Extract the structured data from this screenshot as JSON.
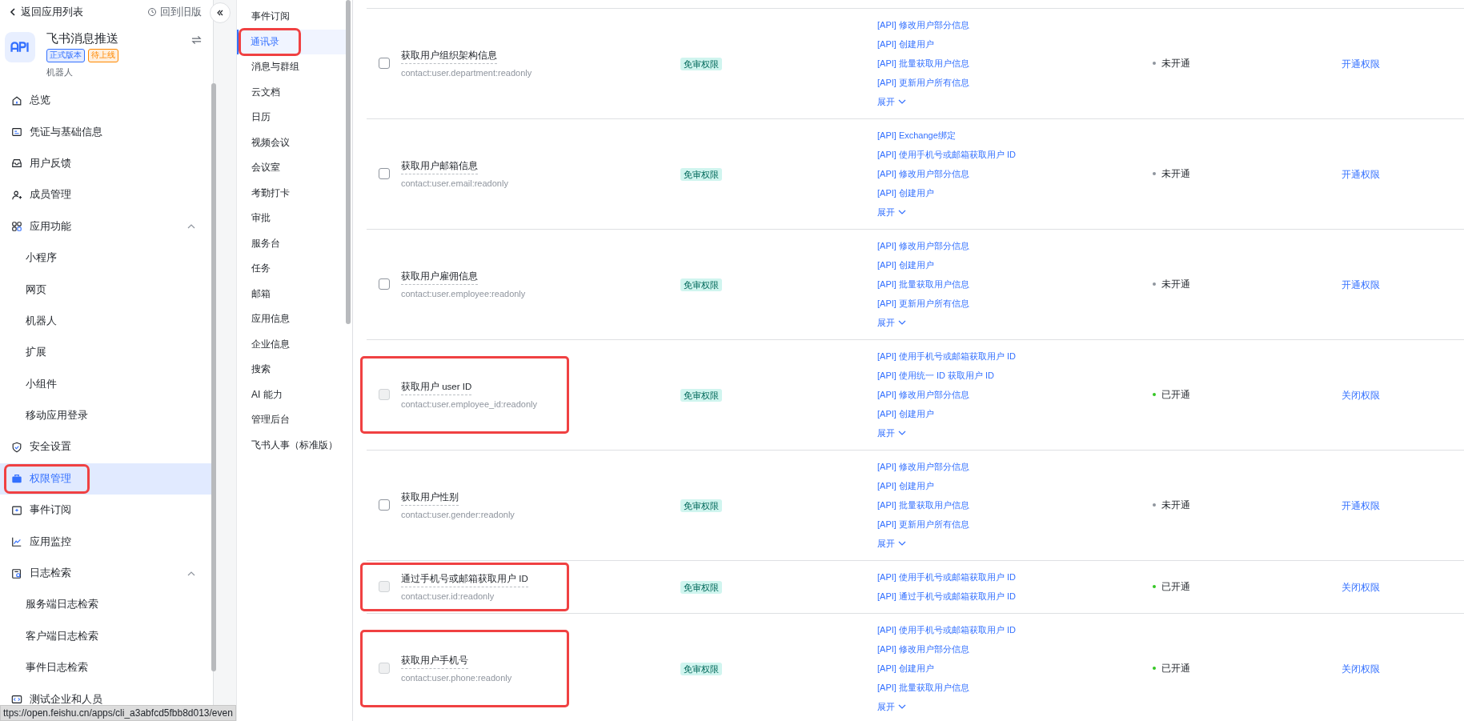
{
  "sidebar": {
    "back_link": "返回应用列表",
    "old_version_link": "回到旧版",
    "app": {
      "name": "飞书消息推送",
      "type": "机器人",
      "tags": [
        {
          "label": "正式版本",
          "color": "#3370ff"
        },
        {
          "label": "待上线",
          "color": "#ff8800"
        }
      ]
    },
    "items": [
      {
        "label": "总览",
        "kind": "item",
        "selected": false,
        "annotated": false
      },
      {
        "label": "凭证与基础信息",
        "kind": "item",
        "selected": false,
        "annotated": false
      },
      {
        "label": "用户反馈",
        "kind": "item",
        "selected": false,
        "annotated": false
      },
      {
        "label": "成员管理",
        "kind": "item",
        "selected": false,
        "annotated": false
      },
      {
        "label": "应用功能",
        "kind": "group",
        "expanded": true,
        "selected": false,
        "annotated": false,
        "children": [
          {
            "label": "小程序",
            "selected": false
          },
          {
            "label": "网页",
            "selected": false
          },
          {
            "label": "机器人",
            "selected": false
          },
          {
            "label": "扩展",
            "selected": false
          },
          {
            "label": "小组件",
            "selected": false
          },
          {
            "label": "移动应用登录",
            "selected": false
          }
        ]
      },
      {
        "label": "安全设置",
        "kind": "item",
        "selected": false,
        "annotated": false
      },
      {
        "label": "权限管理",
        "kind": "item",
        "selected": true,
        "annotated": true
      },
      {
        "label": "事件订阅",
        "kind": "item",
        "selected": false,
        "annotated": false
      },
      {
        "label": "应用监控",
        "kind": "item",
        "selected": false,
        "annotated": false
      },
      {
        "label": "日志检索",
        "kind": "group",
        "expanded": true,
        "selected": false,
        "annotated": false,
        "children": [
          {
            "label": "服务端日志检索",
            "selected": false
          },
          {
            "label": "客户端日志检索",
            "selected": false
          },
          {
            "label": "事件日志检索",
            "selected": false
          }
        ]
      },
      {
        "label": "测试企业和人员",
        "kind": "item",
        "selected": false,
        "annotated": false
      }
    ]
  },
  "status_url": "ttps://open.feishu.cn/apps/cli_a3abfcd5fbb8d013/even",
  "category_nav": [
    {
      "label": "事件订阅",
      "selected": false,
      "annotated": false
    },
    {
      "label": "通讯录",
      "selected": true,
      "annotated": true
    },
    {
      "label": "消息与群组",
      "selected": false,
      "annotated": false
    },
    {
      "label": "云文档",
      "selected": false,
      "annotated": false
    },
    {
      "label": "日历",
      "selected": false,
      "annotated": false
    },
    {
      "label": "视频会议",
      "selected": false,
      "annotated": false
    },
    {
      "label": "会议室",
      "selected": false,
      "annotated": false
    },
    {
      "label": "考勤打卡",
      "selected": false,
      "annotated": false
    },
    {
      "label": "审批",
      "selected": false,
      "annotated": false
    },
    {
      "label": "服务台",
      "selected": false,
      "annotated": false
    },
    {
      "label": "任务",
      "selected": false,
      "annotated": false
    },
    {
      "label": "邮箱",
      "selected": false,
      "annotated": false
    },
    {
      "label": "应用信息",
      "selected": false,
      "annotated": false
    },
    {
      "label": "企业信息",
      "selected": false,
      "annotated": false
    },
    {
      "label": "搜索",
      "selected": false,
      "annotated": false
    },
    {
      "label": "AI 能力",
      "selected": false,
      "annotated": false
    },
    {
      "label": "管理后台",
      "selected": false,
      "annotated": false
    },
    {
      "label": "飞书人事（标准版）",
      "selected": false,
      "annotated": false
    }
  ],
  "permissions": [
    {
      "name": "获取用户组织架构信息",
      "scope": "contact:user.department:readonly",
      "tag": "免审权限",
      "apis": [
        "[API] 修改用户部分信息",
        "[API] 创建用户",
        "[API] 批量获取用户信息",
        "[API] 更新用户所有信息"
      ],
      "expand": "展开",
      "status": "未开通",
      "enabled": false,
      "action": "开通权限",
      "disabled": false,
      "annotated": false
    },
    {
      "name": "获取用户邮箱信息",
      "scope": "contact:user.email:readonly",
      "tag": "免审权限",
      "apis": [
        "[API] Exchange绑定",
        "[API] 使用手机号或邮箱获取用户 ID",
        "[API] 修改用户部分信息",
        "[API] 创建用户"
      ],
      "expand": "展开",
      "status": "未开通",
      "enabled": false,
      "action": "开通权限",
      "disabled": false,
      "annotated": false
    },
    {
      "name": "获取用户雇佣信息",
      "scope": "contact:user.employee:readonly",
      "tag": "免审权限",
      "apis": [
        "[API] 修改用户部分信息",
        "[API] 创建用户",
        "[API] 批量获取用户信息",
        "[API] 更新用户所有信息"
      ],
      "expand": "展开",
      "status": "未开通",
      "enabled": false,
      "action": "开通权限",
      "disabled": false,
      "annotated": false
    },
    {
      "name": "获取用户 user ID",
      "scope": "contact:user.employee_id:readonly",
      "tag": "免审权限",
      "apis": [
        "[API] 使用手机号或邮箱获取用户 ID",
        "[API] 使用统一 ID 获取用户 ID",
        "[API] 修改用户部分信息",
        "[API] 创建用户"
      ],
      "expand": "展开",
      "status": "已开通",
      "enabled": true,
      "action": "关闭权限",
      "disabled": true,
      "annotated": true
    },
    {
      "name": "获取用户性别",
      "scope": "contact:user.gender:readonly",
      "tag": "免审权限",
      "apis": [
        "[API] 修改用户部分信息",
        "[API] 创建用户",
        "[API] 批量获取用户信息",
        "[API] 更新用户所有信息"
      ],
      "expand": "展开",
      "status": "未开通",
      "enabled": false,
      "action": "开通权限",
      "disabled": false,
      "annotated": false
    },
    {
      "name": "通过手机号或邮箱获取用户 ID",
      "scope": "contact:user.id:readonly",
      "tag": "免审权限",
      "apis": [
        "[API] 使用手机号或邮箱获取用户 ID",
        "[API] 通过手机号或邮箱获取用户 ID"
      ],
      "status": "已开通",
      "enabled": true,
      "action": "关闭权限",
      "disabled": true,
      "annotated": true
    },
    {
      "name": "获取用户手机号",
      "scope": "contact:user.phone:readonly",
      "tag": "免审权限",
      "apis": [
        "[API] 使用手机号或邮箱获取用户 ID",
        "[API] 修改用户部分信息",
        "[API] 创建用户",
        "[API] 批量获取用户信息"
      ],
      "expand": "展开",
      "status": "已开通",
      "enabled": true,
      "action": "关闭权限",
      "disabled": true,
      "annotated": true
    }
  ]
}
